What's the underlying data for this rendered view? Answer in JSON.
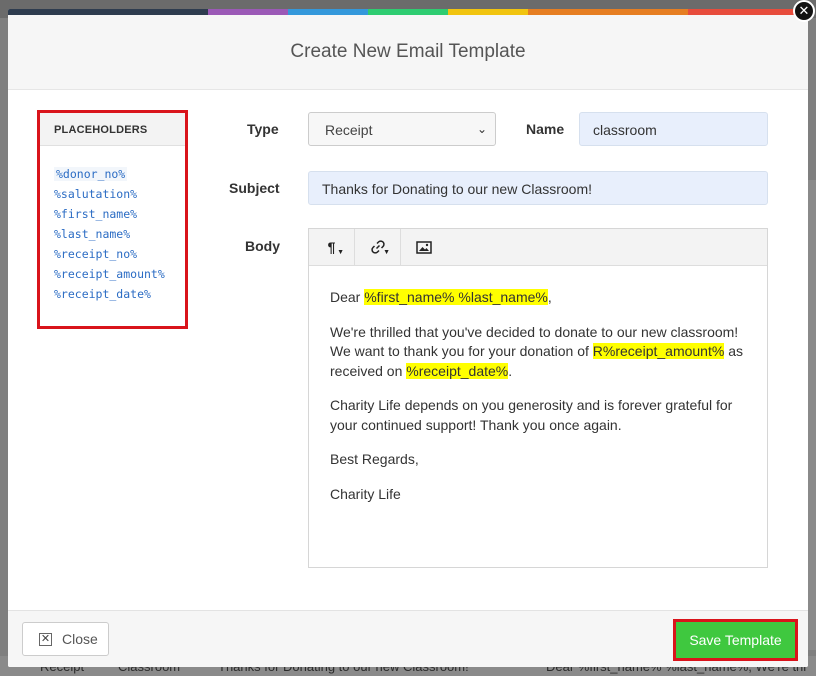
{
  "modal": {
    "title": "Create New Email Template",
    "stripe_colors": [
      "#2e3c4f",
      "#9b59b6",
      "#3498db",
      "#2ecc71",
      "#f1c40f",
      "#e67e22",
      "#e74c3c"
    ]
  },
  "placeholders": {
    "heading": "PLACEHOLDERS",
    "items": [
      "%donor_no%",
      "%salutation%",
      "%first_name%",
      "%last_name%",
      "%receipt_no%",
      "%receipt_amount%",
      "%receipt_date%"
    ]
  },
  "form": {
    "type_label": "Type",
    "type_value": "Receipt",
    "name_label": "Name",
    "name_value": "classroom",
    "subject_label": "Subject",
    "subject_value": "Thanks for Donating to our new Classroom!",
    "body_label": "Body"
  },
  "editor": {
    "toolbar": [
      {
        "icon": "paragraph-icon",
        "glyph": "¶"
      },
      {
        "icon": "link-icon",
        "glyph": "🔗"
      },
      {
        "icon": "image-icon",
        "glyph": "▣"
      }
    ],
    "p1_a": "Dear ",
    "p1_hl": "%first_name% %last_name%",
    "p1_b": ",",
    "p2_a": "We're thrilled that you've decided to donate to our new classroom! We want to thank you for your donation of ",
    "p2_hl1": "R%receipt_amount%",
    "p2_b": " as received on ",
    "p2_hl2": "%receipt_date%",
    "p2_c": ".",
    "p3": "Charity Life depends on you generosity and is forever grateful for your continued support! Thank you once again.",
    "p4": "Best Regards,",
    "p5": "Charity Life"
  },
  "footer": {
    "close_label": "Close",
    "save_label": "Save Template"
  },
  "background": {
    "row_type": "Receipt",
    "row_name": "Classroom",
    "row_subject": "Thanks for Donating to our new Classroom!",
    "row_body": "Dear %first_name% %last_name%, We're thr"
  }
}
